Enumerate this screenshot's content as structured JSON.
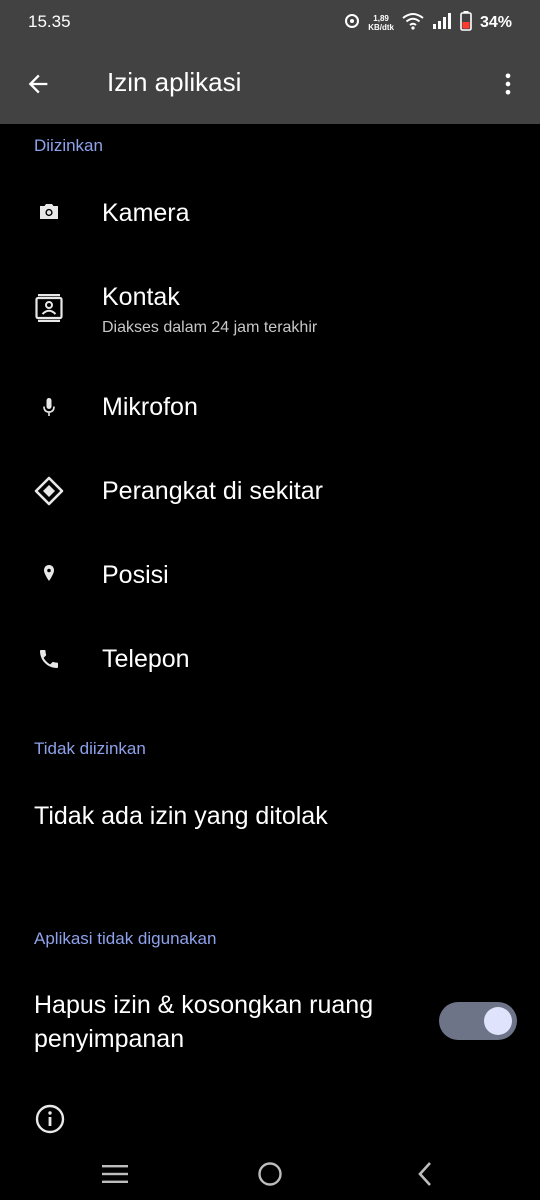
{
  "status_bar": {
    "time": "15.35",
    "speed_value": "1,89",
    "speed_unit": "KB/dtk",
    "battery": "34%"
  },
  "app_bar": {
    "title": "Izin aplikasi"
  },
  "sections": {
    "allowed": {
      "header": "Diizinkan",
      "items": [
        {
          "label": "Kamera",
          "subtitle": ""
        },
        {
          "label": "Kontak",
          "subtitle": "Diakses dalam 24 jam terakhir"
        },
        {
          "label": "Mikrofon",
          "subtitle": ""
        },
        {
          "label": "Perangkat di sekitar",
          "subtitle": ""
        },
        {
          "label": "Posisi",
          "subtitle": ""
        },
        {
          "label": "Telepon",
          "subtitle": ""
        }
      ]
    },
    "denied": {
      "header": "Tidak diizinkan",
      "empty_text": "Tidak ada izin yang ditolak"
    },
    "unused": {
      "header": "Aplikasi tidak digunakan",
      "toggle_line1": "Hapus izin & kosongkan ruang",
      "toggle_line2": "penyimpanan",
      "toggle_on": true
    }
  },
  "colors": {
    "accent": "#8ea2ec",
    "top_bar": "#424242",
    "background": "#000000"
  },
  "icons": {
    "back": "arrow-left-icon",
    "more": "more-vert-icon",
    "camera": "camera-icon",
    "contacts": "contacts-icon",
    "microphone": "microphone-icon",
    "nearby": "nearby-devices-icon",
    "location": "location-pin-icon",
    "phone": "phone-icon",
    "info": "info-icon",
    "nav_recents": "menu-icon",
    "nav_home": "home-circle-icon",
    "nav_back": "chevron-left-icon"
  }
}
